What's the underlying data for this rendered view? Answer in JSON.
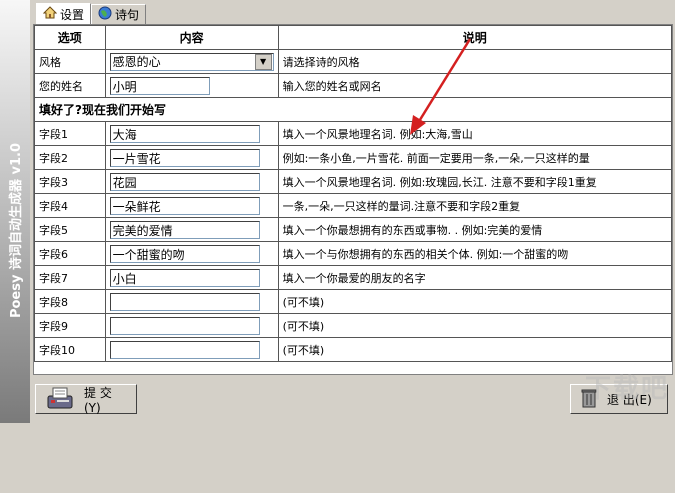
{
  "app": {
    "vertical_title": "Poesy 诗词自动生成器 v1.0"
  },
  "tabs": [
    {
      "label": "设置",
      "icon": "home-icon",
      "active": true
    },
    {
      "label": "诗句",
      "icon": "globe-icon",
      "active": false
    }
  ],
  "table": {
    "headers": [
      "选项",
      "内容",
      "说明"
    ],
    "style": {
      "label": "风格",
      "value": "感恩的心",
      "hint": "请选择诗的风格"
    },
    "name": {
      "label": "您的姓名",
      "value": "小明",
      "hint": "输入您的姓名或网名"
    },
    "section_title": "填好了?现在我们开始写",
    "fields": [
      {
        "label": "字段1",
        "value": "大海",
        "hint": "填入一个风景地理名词.  例如:大海,雪山"
      },
      {
        "label": "字段2",
        "value": "一片雪花",
        "hint": "例如:一条小鱼,一片雪花. 前面一定要用一条,一朵,一只这样的量"
      },
      {
        "label": "字段3",
        "value": "花园",
        "hint": "填入一个风景地理名词.  例如:玫瑰园,长江. 注意不要和字段1重复"
      },
      {
        "label": "字段4",
        "value": "一朵鲜花",
        "hint": "一条,一朵,一只这样的量词.注意不要和字段2重复"
      },
      {
        "label": "字段5",
        "value": "完美的爱情",
        "hint": "填入一个你最想拥有的东西或事物. . 例如:完美的爱情"
      },
      {
        "label": "字段6",
        "value": "一个甜蜜的吻",
        "hint": "填入一个与你想拥有的东西的相关个体.  例如:一个甜蜜的吻"
      },
      {
        "label": "字段7",
        "value": "小白",
        "hint": "填入一个你最爱的朋友的名字"
      },
      {
        "label": "字段8",
        "value": "",
        "hint": "(可不填)"
      },
      {
        "label": "字段9",
        "value": "",
        "hint": "(可不填)"
      },
      {
        "label": "字段10",
        "value": "",
        "hint": "(可不填)"
      }
    ]
  },
  "buttons": {
    "submit": "提 交(Y)",
    "exit": "退 出(E)"
  },
  "watermark": "下载吧"
}
